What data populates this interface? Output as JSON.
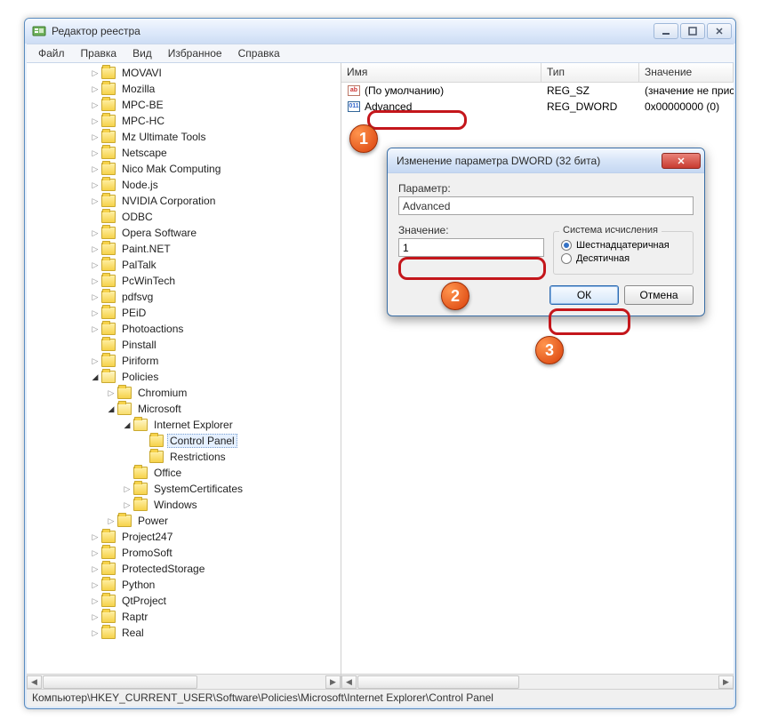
{
  "window": {
    "title": "Редактор реестра"
  },
  "menu": {
    "file": "Файл",
    "edit": "Правка",
    "view": "Вид",
    "favorites": "Избранное",
    "help": "Справка"
  },
  "tree": {
    "items": [
      {
        "depth": 3,
        "toggle": "▷",
        "label": "MOVAVI"
      },
      {
        "depth": 3,
        "toggle": "▷",
        "label": "Mozilla"
      },
      {
        "depth": 3,
        "toggle": "▷",
        "label": "MPC-BE"
      },
      {
        "depth": 3,
        "toggle": "▷",
        "label": "MPC-HC"
      },
      {
        "depth": 3,
        "toggle": "▷",
        "label": "Mz Ultimate Tools"
      },
      {
        "depth": 3,
        "toggle": "▷",
        "label": "Netscape"
      },
      {
        "depth": 3,
        "toggle": "▷",
        "label": "Nico Mak Computing"
      },
      {
        "depth": 3,
        "toggle": "▷",
        "label": "Node.js"
      },
      {
        "depth": 3,
        "toggle": "▷",
        "label": "NVIDIA Corporation"
      },
      {
        "depth": 3,
        "toggle": " ",
        "label": "ODBC"
      },
      {
        "depth": 3,
        "toggle": "▷",
        "label": "Opera Software"
      },
      {
        "depth": 3,
        "toggle": "▷",
        "label": "Paint.NET"
      },
      {
        "depth": 3,
        "toggle": "▷",
        "label": "PalTalk"
      },
      {
        "depth": 3,
        "toggle": "▷",
        "label": "PcWinTech"
      },
      {
        "depth": 3,
        "toggle": "▷",
        "label": "pdfsvg"
      },
      {
        "depth": 3,
        "toggle": "▷",
        "label": "PEiD"
      },
      {
        "depth": 3,
        "toggle": "▷",
        "label": "Photoactions"
      },
      {
        "depth": 3,
        "toggle": " ",
        "label": "Pinstall"
      },
      {
        "depth": 3,
        "toggle": "▷",
        "label": "Piriform"
      },
      {
        "depth": 3,
        "toggle": "�องก",
        "label": "Policies",
        "open": true
      },
      {
        "depth": 4,
        "toggle": "▷",
        "label": "Chromium"
      },
      {
        "depth": 4,
        "toggle": "▿",
        "label": "Microsoft",
        "open": true
      },
      {
        "depth": 5,
        "toggle": "▿",
        "label": "Internet Explorer",
        "open": true
      },
      {
        "depth": 6,
        "toggle": " ",
        "label": "Control Panel",
        "selected": true
      },
      {
        "depth": 6,
        "toggle": " ",
        "label": "Restrictions"
      },
      {
        "depth": 5,
        "toggle": " ",
        "label": "Office"
      },
      {
        "depth": 5,
        "toggle": "▷",
        "label": "SystemCertificates"
      },
      {
        "depth": 5,
        "toggle": "▷",
        "label": "Windows"
      },
      {
        "depth": 4,
        "toggle": "▷",
        "label": "Power"
      },
      {
        "depth": 3,
        "toggle": "▷",
        "label": "Project247"
      },
      {
        "depth": 3,
        "toggle": "▷",
        "label": "PromoSoft"
      },
      {
        "depth": 3,
        "toggle": "▷",
        "label": "ProtectedStorage"
      },
      {
        "depth": 3,
        "toggle": "▷",
        "label": "Python"
      },
      {
        "depth": 3,
        "toggle": "▷",
        "label": "QtProject"
      },
      {
        "depth": 3,
        "toggle": "▷",
        "label": "Raptr"
      },
      {
        "depth": 3,
        "toggle": "▷",
        "label": "Real"
      }
    ]
  },
  "list": {
    "columns": {
      "name": "Имя",
      "type": "Тип",
      "value": "Значение"
    },
    "col_widths": {
      "name": 225,
      "type": 110,
      "value": 130
    },
    "rows": [
      {
        "icon": "sz",
        "name": "(По умолчанию)",
        "type": "REG_SZ",
        "value": "(значение не присво"
      },
      {
        "icon": "dw",
        "name": "Advanced",
        "type": "REG_DWORD",
        "value": "0x00000000 (0)"
      }
    ]
  },
  "status": {
    "path": "Компьютер\\HKEY_CURRENT_USER\\Software\\Policies\\Microsoft\\Internet Explorer\\Control Panel"
  },
  "dialog": {
    "title": "Изменение параметра DWORD (32 бита)",
    "param_label": "Параметр:",
    "param_value": "Advanced",
    "value_label": "Значение:",
    "value_value": "1",
    "base_legend": "Система исчисления",
    "radio_hex": "Шестнадцатеричная",
    "radio_dec": "Десятичная",
    "ok": "ОК",
    "cancel": "Отмена"
  },
  "annotations": {
    "b1": "1",
    "b2": "2",
    "b3": "3"
  }
}
